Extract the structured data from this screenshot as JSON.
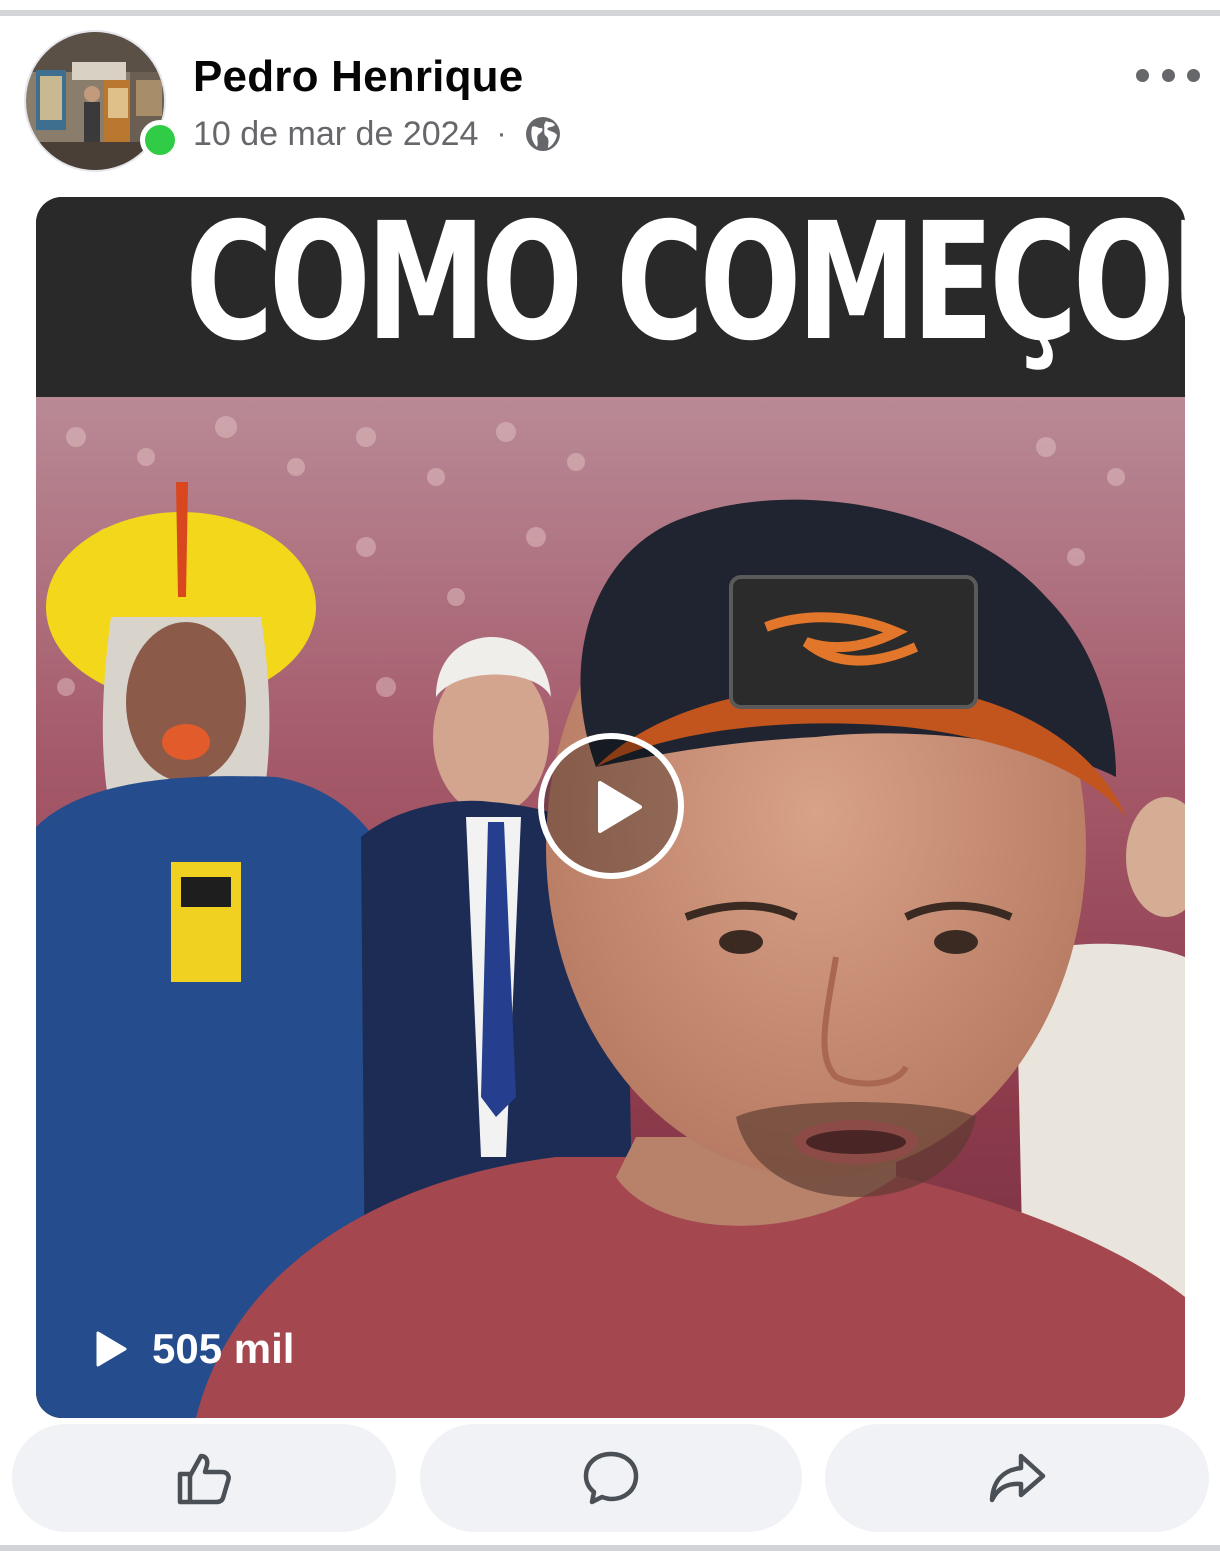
{
  "post": {
    "author": "Pedro Henrique",
    "date": "10 de mar de 2024",
    "separator": "·",
    "privacy_icon": "globe-icon",
    "online": true,
    "more_icon": "more-options-icon"
  },
  "video": {
    "caption": "COMO COMEÇOU",
    "view_count": "505 mil",
    "play_icon": "play-icon"
  },
  "actions": [
    {
      "name": "like",
      "icon": "thumbs-up-icon"
    },
    {
      "name": "comment",
      "icon": "comment-icon"
    },
    {
      "name": "share",
      "icon": "share-icon"
    }
  ],
  "colors": {
    "online_green": "#31cc46",
    "muted_text": "#65676b",
    "button_bg": "#f0f2f5",
    "divider": "#d2d4d8"
  }
}
